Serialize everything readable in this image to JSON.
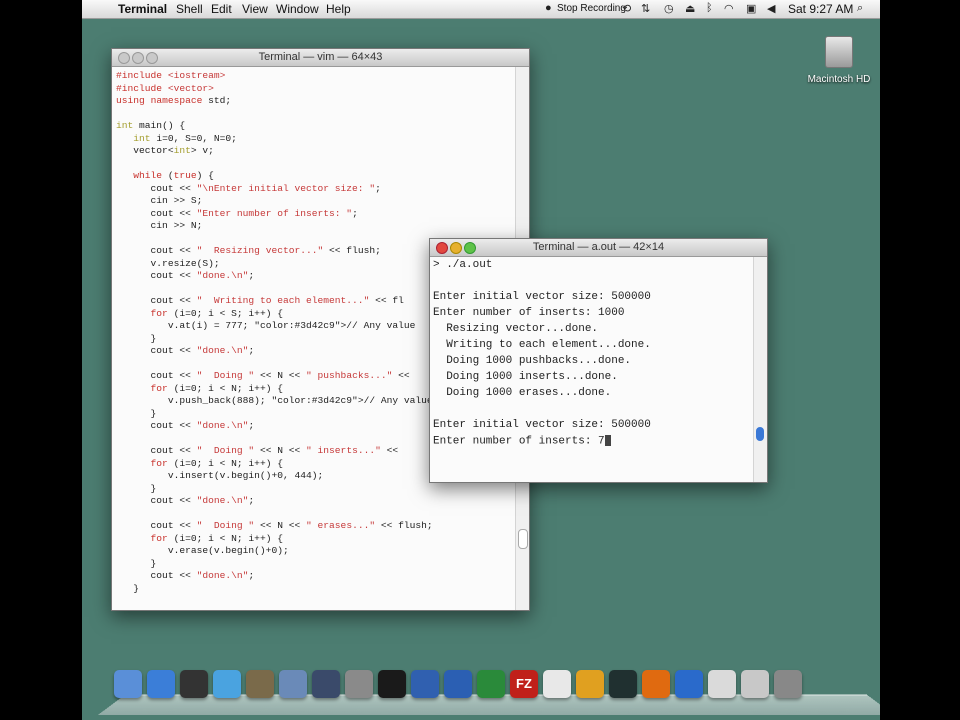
{
  "menubar": {
    "app": "Terminal",
    "items": [
      "Shell",
      "Edit",
      "View",
      "Window",
      "Help"
    ],
    "status": {
      "recording": "Stop Recording",
      "clock": "Sat 9:27 AM"
    }
  },
  "desktop": {
    "hd_label": "Macintosh HD"
  },
  "vim_window": {
    "title": "Terminal — vim — 64×43",
    "lines": [
      "#include <iostream>",
      "#include <vector>",
      "using namespace std;",
      "",
      "int main() {",
      "   int i=0, S=0, N=0;",
      "   vector<int> v;",
      "",
      "   while (true) {",
      "      cout << \"\\nEnter initial vector size: \";",
      "      cin >> S;",
      "      cout << \"Enter number of inserts: \";",
      "      cin >> N;",
      "",
      "      cout << \"  Resizing vector...\" << flush;",
      "      v.resize(S);",
      "      cout << \"done.\\n\";",
      "",
      "      cout << \"  Writing to each element...\" << fl",
      "      for (i=0; i < S; i++) {",
      "         v.at(i) = 777; // Any value",
      "      }",
      "      cout << \"done.\\n\";",
      "",
      "      cout << \"  Doing \" << N << \" pushbacks...\" <<",
      "      for (i=0; i < N; i++) {",
      "         v.push_back(888); // Any value",
      "      }",
      "      cout << \"done.\\n\";",
      "",
      "      cout << \"  Doing \" << N << \" inserts...\" << ",
      "      for (i=0; i < N; i++) {",
      "         v.insert(v.begin()+0, 444);",
      "      }",
      "      cout << \"done.\\n\";",
      "",
      "      cout << \"  Doing \" << N << \" erases...\" << flush;",
      "      for (i=0; i < N; i++) {",
      "         v.erase(v.begin()+0);",
      "      }",
      "      cout << \"done.\\n\";",
      "   }"
    ]
  },
  "aout_window": {
    "title": "Terminal — a.out — 42×14",
    "lines": [
      "> ./a.out",
      "",
      "Enter initial vector size: 500000",
      "Enter number of inserts: 1000",
      "  Resizing vector...done.",
      "  Writing to each element...done.",
      "  Doing 1000 pushbacks...done.",
      "  Doing 1000 inserts...done.",
      "  Doing 1000 erases...done.",
      "",
      "Enter initial vector size: 500000",
      "Enter number of inserts: 7"
    ]
  },
  "colors": {
    "desktop": "#4c7d71",
    "keyword": "#c8312c",
    "type": "#a49e2e",
    "string": "#c63a3a",
    "comment": "#3d42c9"
  },
  "dock": {
    "icons": [
      "finder-icon",
      "app-store-icon",
      "dashboard-icon",
      "itunes-icon",
      "iphoto-icon",
      "preview-icon",
      "mission-control-icon",
      "system-preferences-icon",
      "terminal-icon",
      "thunderbird-icon",
      "word-icon",
      "excel-icon",
      "filezilla-icon",
      "textedit-icon",
      "chrome-icon",
      "activity-monitor-icon",
      "firefox-icon",
      "network-icon",
      "screenshot-icon",
      "stack-icon",
      "trash-icon"
    ],
    "filezilla_label": "FZ"
  }
}
